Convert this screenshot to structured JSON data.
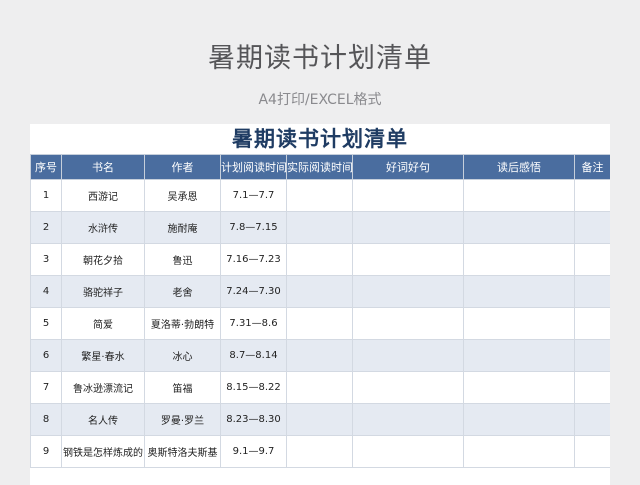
{
  "page": {
    "title": "暑期读书计划清单",
    "subtitle": "A4打印/EXCEL格式"
  },
  "sheet": {
    "title": "暑期读书计划清单",
    "headers": [
      "序号",
      "书名",
      "作者",
      "计划阅读时间",
      "实际阅读时间",
      "好词好句",
      "读后感悟",
      "备注"
    ],
    "rows": [
      [
        "1",
        "西游记",
        "吴承恩",
        "7.1—7.7",
        "",
        "",
        "",
        ""
      ],
      [
        "2",
        "水浒传",
        "施耐庵",
        "7.8—7.15",
        "",
        "",
        "",
        ""
      ],
      [
        "3",
        "朝花夕拾",
        "鲁迅",
        "7.16—7.23",
        "",
        "",
        "",
        ""
      ],
      [
        "4",
        "骆驼祥子",
        "老舍",
        "7.24—7.30",
        "",
        "",
        "",
        ""
      ],
      [
        "5",
        "简爱",
        "夏洛蒂·勃朗特",
        "7.31—8.6",
        "",
        "",
        "",
        ""
      ],
      [
        "6",
        "繁星·春水",
        "冰心",
        "8.7—8.14",
        "",
        "",
        "",
        ""
      ],
      [
        "7",
        "鲁冰逊漂流记",
        "笛福",
        "8.15—8.22",
        "",
        "",
        "",
        ""
      ],
      [
        "8",
        "名人传",
        "罗曼·罗兰",
        "8.23—8.30",
        "",
        "",
        "",
        ""
      ],
      [
        "9",
        "钢铁是怎样炼成的",
        "奥斯特洛夫斯基",
        "9.1—9.7",
        "",
        "",
        "",
        ""
      ]
    ]
  }
}
